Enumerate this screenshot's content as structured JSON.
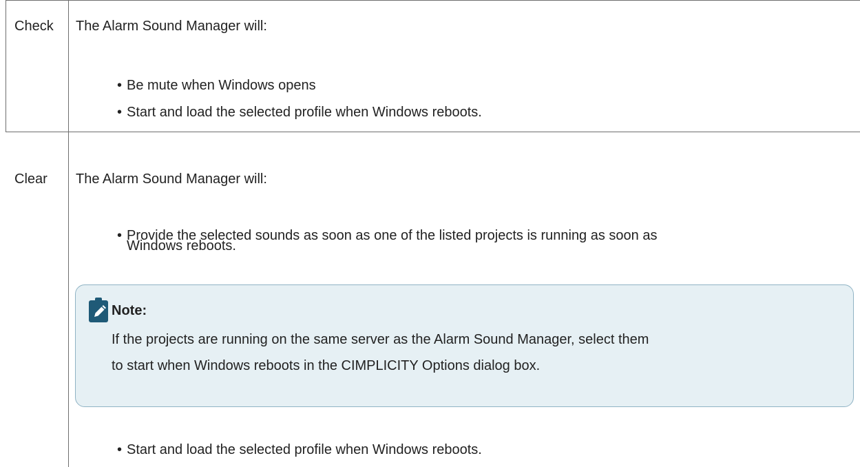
{
  "rows": [
    {
      "option": "Check",
      "intro": "The Alarm Sound Manager will:",
      "bullets": [
        "Be mute when Windows opens",
        "Start and load the selected profile when Windows reboots."
      ]
    },
    {
      "option": "Clear",
      "intro": "The Alarm Sound Manager will:",
      "bullets": [
        "Provide the selected sounds as soon as one of the listed projects is running as soon as",
        "Windows reboots.",
        "Start and load the selected profile when Windows reboots."
      ],
      "note": {
        "title": "Note:",
        "body_lines": [
          "If the projects are running on the same server as the Alarm Sound Manager, select them",
          "to start when Windows reboots in the CIMPLICITY Options dialog box."
        ],
        "icon": "pencil-note-icon"
      }
    }
  ],
  "bullet_symbol": "•",
  "colors": {
    "note_background": "#e6f0f4",
    "note_border": "#8fb3c4",
    "note_icon": "#1f5a77",
    "text": "#222222",
    "grid_line": "#6e6e6e"
  }
}
